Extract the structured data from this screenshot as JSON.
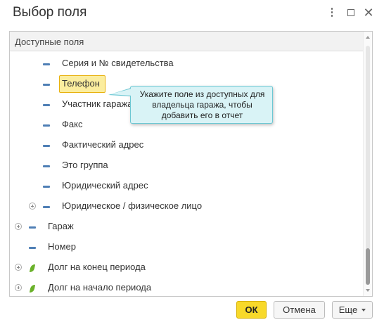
{
  "window": {
    "title": "Выбор поля"
  },
  "panel": {
    "header": "Доступные поля",
    "items": [
      {
        "label": "Серия и № свидетельства",
        "icon": "field-icon",
        "level": 2,
        "expandable": false
      },
      {
        "label": "Телефон",
        "icon": "field-icon",
        "level": 2,
        "expandable": false,
        "selected": true
      },
      {
        "label": "Участник гаража",
        "icon": "field-icon",
        "level": 2,
        "expandable": false
      },
      {
        "label": "Факс",
        "icon": "field-icon",
        "level": 2,
        "expandable": false
      },
      {
        "label": "Фактический адрес",
        "icon": "field-icon",
        "level": 2,
        "expandable": false
      },
      {
        "label": "Это группа",
        "icon": "field-icon",
        "level": 2,
        "expandable": false
      },
      {
        "label": "Юридический адрес",
        "icon": "field-icon",
        "level": 2,
        "expandable": false
      },
      {
        "label": "Юридическое / физическое лицо",
        "icon": "field-icon",
        "level": 2,
        "expandable": true
      },
      {
        "label": "Гараж",
        "icon": "field-icon",
        "level": 1,
        "expandable": true
      },
      {
        "label": "Номер",
        "icon": "field-icon",
        "level": 1,
        "expandable": false
      },
      {
        "label": "Долг на конец периода",
        "icon": "resource-icon",
        "level": 1,
        "expandable": true
      },
      {
        "label": "Долг на начало периода",
        "icon": "resource-icon",
        "level": 1,
        "expandable": true
      }
    ]
  },
  "tooltip": {
    "text": "Укажите поле из доступных для владельца гаража, чтобы добавить его в отчет"
  },
  "buttons": {
    "ok": "ОК",
    "cancel": "Отмена",
    "more": "Еще"
  },
  "colors": {
    "selection_fill": "#fbed9e",
    "selection_border": "#e8b10d",
    "tooltip_fill": "#d9f3f6",
    "tooltip_border": "#6cc7d3",
    "ok_button": "#f8d92a",
    "field_icon": "#4f7fb5",
    "resource_icon": "#6ab12a"
  }
}
